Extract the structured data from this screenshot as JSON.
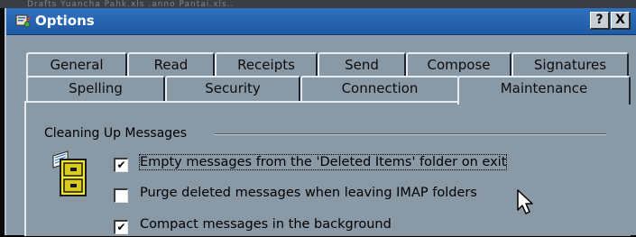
{
  "background_strip": {
    "text": "Drafts   Yuancha Pahk.xls   .anno Pantai.xls.."
  },
  "window": {
    "title": "Options",
    "help_button": "?",
    "close_button": "X"
  },
  "tabs": {
    "row1": [
      "General",
      "Read",
      "Receipts",
      "Send",
      "Compose",
      "Signatures"
    ],
    "row2": [
      "Spelling",
      "Security",
      "Connection",
      "Maintenance"
    ],
    "active": "Maintenance"
  },
  "cleaning": {
    "group_label": "Cleaning Up Messages",
    "options": [
      {
        "label": "Empty messages from the 'Deleted Items' folder on exit",
        "checked": true,
        "focused": true
      },
      {
        "label": "Purge deleted messages when leaving IMAP folders",
        "checked": false,
        "focused": false
      },
      {
        "label": "Compact messages in the background",
        "checked": true,
        "focused": false
      }
    ]
  },
  "colors": {
    "titlebar": "#2f6fbc",
    "dialog_face": "#8a99a6"
  },
  "icons": {
    "title": "options-app-icon",
    "group": "file-cabinet-icon",
    "pointer": "mouse-pointer-icon"
  }
}
